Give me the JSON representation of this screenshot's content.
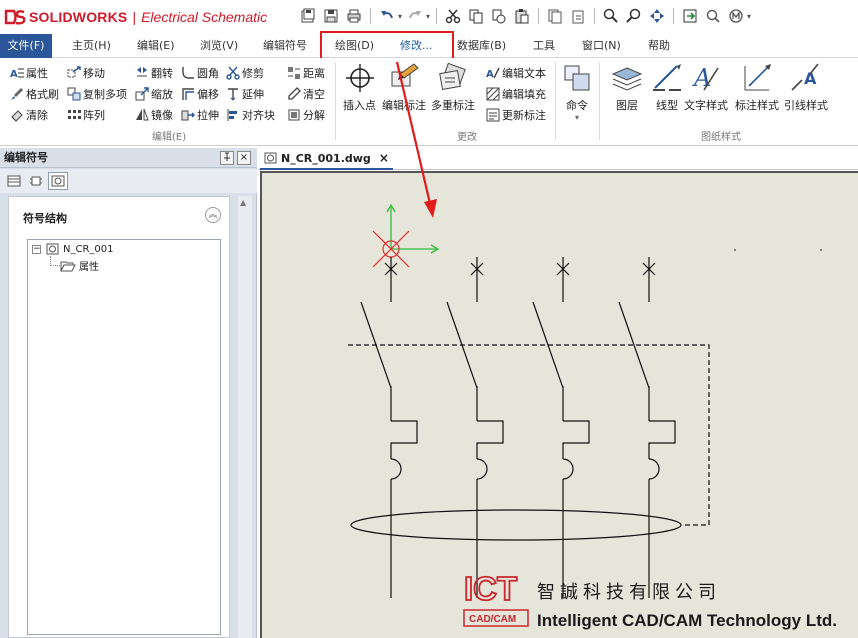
{
  "app": {
    "brand": "SOLIDWORKS",
    "separator": "|",
    "product": "Electrical Schematic",
    "brand_color": "#d11a2a"
  },
  "quick_access": [
    {
      "icon": "save-all-icon"
    },
    {
      "icon": "save-icon"
    },
    {
      "icon": "print-icon"
    },
    {
      "icon": "undo-icon"
    },
    {
      "icon": "redo-icon"
    },
    {
      "icon": "cut-icon"
    },
    {
      "icon": "copy-icon"
    },
    {
      "icon": "copy-special-icon"
    },
    {
      "icon": "paste-icon"
    },
    {
      "icon": "copy-page-icon"
    },
    {
      "icon": "paste-page-icon"
    },
    {
      "icon": "zoom-window-icon"
    },
    {
      "icon": "zoom-dynamic-icon"
    },
    {
      "icon": "pan-icon"
    },
    {
      "icon": "export-icon"
    },
    {
      "icon": "search-icon"
    },
    {
      "icon": "macro-icon"
    }
  ],
  "menu_tabs": [
    {
      "label": "文件(F)"
    },
    {
      "label": "主页(H)"
    },
    {
      "label": "编辑(E)"
    },
    {
      "label": "浏览(V)"
    },
    {
      "label": "编辑符号"
    },
    {
      "label": "绘图(D)"
    },
    {
      "label": "修改..."
    },
    {
      "label": "数据库(B)"
    },
    {
      "label": "工具"
    },
    {
      "label": "窗口(N)"
    },
    {
      "label": "帮助"
    }
  ],
  "ribbon": {
    "edit_group": {
      "label": "编辑(E)",
      "buttons": [
        {
          "label": "属性"
        },
        {
          "label": "格式刷"
        },
        {
          "label": "清除"
        },
        {
          "label": "移动"
        },
        {
          "label": "复制多项"
        },
        {
          "label": "阵列"
        },
        {
          "label": "翻转"
        },
        {
          "label": "缩放"
        },
        {
          "label": "镜像"
        },
        {
          "label": "圆角"
        },
        {
          "label": "偏移"
        },
        {
          "label": "拉伸"
        },
        {
          "label": "修剪"
        },
        {
          "label": "延伸"
        },
        {
          "label": "对齐块"
        },
        {
          "label": "距离"
        },
        {
          "label": "清空"
        },
        {
          "label": "分解"
        }
      ]
    },
    "modify_group": {
      "label": "更改",
      "large": [
        {
          "label": "插入点"
        },
        {
          "label": "编辑标注"
        },
        {
          "label": "多重标注"
        }
      ],
      "small": [
        {
          "label": "编辑文本"
        },
        {
          "label": "编辑填充"
        },
        {
          "label": "更新标注"
        }
      ]
    },
    "command": {
      "label": "命令"
    },
    "style_group": {
      "label": "图纸样式",
      "large": [
        {
          "label": "图层"
        },
        {
          "label": "线型"
        },
        {
          "label": "文字样式"
        },
        {
          "label": "标注样式"
        },
        {
          "label": "引线样式"
        }
      ]
    }
  },
  "panel": {
    "title": "编辑符号",
    "pin": "ᵖ",
    "close": "×",
    "structure_title": "符号结构",
    "tree": {
      "root": "N_CR_001",
      "child": "属性"
    }
  },
  "document": {
    "tab": "N_CR_001.dwg",
    "close": "×"
  },
  "watermark": {
    "ict": "ICT",
    "ict_sub": "CAD/CAM",
    "company_cn": "智誠科技有限公司",
    "company_en": "Intelligent CAD/CAM Technology Ltd.",
    "color": "#c8272f"
  }
}
